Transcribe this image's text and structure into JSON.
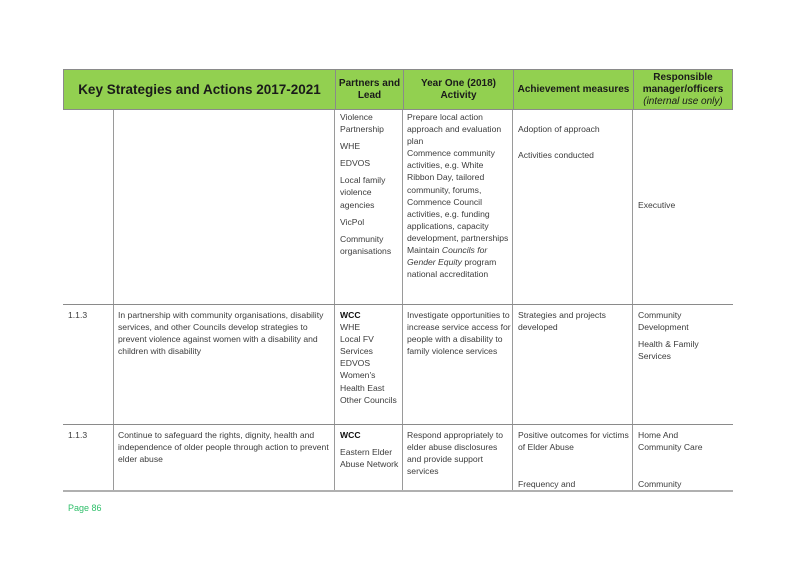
{
  "header": {
    "title": "Key Strategies and Actions 2017-2021",
    "partners": "Partners and Lead",
    "activity": "Year One (2018) Activity",
    "measures": "Achievement measures",
    "responsible": "Responsible manager/officers",
    "responsible_note": "(internal use only)"
  },
  "rows": [
    {
      "number": "",
      "strategy": "",
      "partners": [
        "Violence Partnership",
        "WHE",
        "EDVOS",
        "Local family violence agencies",
        "VicPol",
        "Community organisations"
      ],
      "activity": {
        "line1": "Prepare local action approach and evaluation plan",
        "line2": "Commence community activities, e.g. White Ribbon Day, tailored community, forums,",
        "line3": "Commence Council activities, e.g. funding applications, capacity development, partnerships",
        "line4_pre": "Maintain ",
        "line4_italic": "Councils for Gender Equity",
        "line4_post": " program national accreditation"
      },
      "measures": [
        "Adoption of approach",
        "Activities conducted"
      ],
      "responsible": [
        "Executive"
      ]
    },
    {
      "number": "1.1.3",
      "strategy": "In partnership with community organisations, disability services, and other Councils develop strategies to prevent violence against women with a disability and children with disability",
      "partners_lead": "WCC",
      "partners": [
        "WHE",
        "Local FV Services",
        "EDVOS",
        "Women's Health East",
        "Other Councils"
      ],
      "activity": "Investigate opportunities to increase service access for people with a disability to family violence services",
      "measures": [
        "Strategies and projects developed"
      ],
      "responsible": [
        "Community Development",
        "Health & Family Services"
      ]
    },
    {
      "number": "1.1.3",
      "strategy": "Continue to safeguard the rights, dignity, health and independence of older people through action to prevent elder abuse",
      "partners_lead": "WCC",
      "partners": [
        "Eastern Elder Abuse Network"
      ],
      "activity": "Respond appropriately to elder abuse disclosures and provide support services",
      "measures": [
        "Positive outcomes for victims of Elder Abuse",
        "Frequency and"
      ],
      "responsible": [
        "Home And Community Care",
        "Community"
      ]
    }
  ],
  "footer": {
    "page": "Page 86"
  }
}
